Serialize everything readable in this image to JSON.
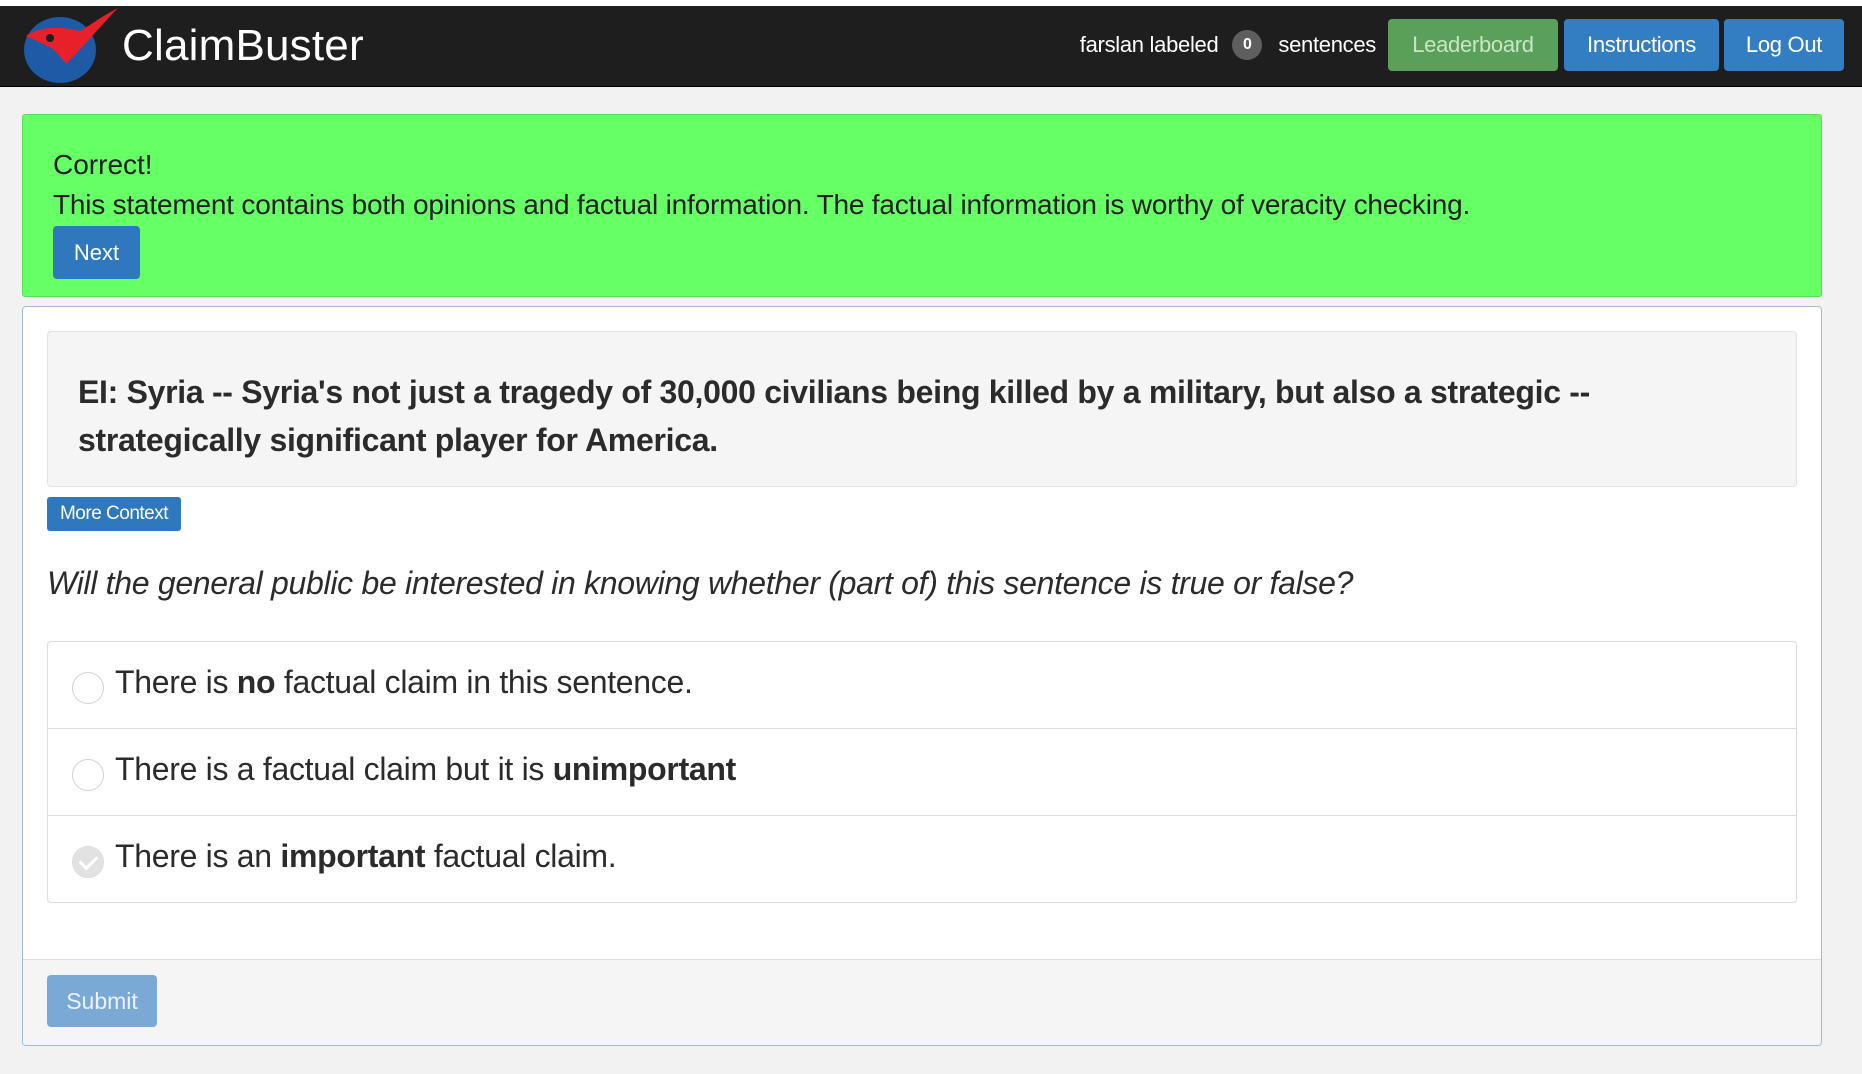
{
  "navbar": {
    "brand_name": "ClaimBuster",
    "username": "farslan",
    "labeled_text": "labeled",
    "count": "0",
    "sentences_text": "sentences",
    "leaderboard_label": "Leaderboard",
    "instructions_label": "Instructions",
    "logout_label": "Log Out",
    "brand_colors": {
      "red": "#e8202a",
      "blue": "#1f5aa6"
    }
  },
  "alert": {
    "title": "Correct!",
    "message": "This statement contains both opinions and factual information. The factual information is worthy of veracity checking.",
    "next_label": "Next",
    "color": "#66ff66"
  },
  "sentence": {
    "text": "EI: Syria -- Syria's not just a tragedy of 30,000 civilians being killed by a military, but also a strategic -- strategically significant player for America."
  },
  "more_context_label": "More Context",
  "question": "Will the general public be interested in knowing whether (part of) this sentence is true or false?",
  "options": [
    {
      "pre": "There is ",
      "bold": "no",
      "post": " factual claim in this sentence.",
      "checked": false
    },
    {
      "pre": "There is a factual claim but it is ",
      "bold": "unimportant",
      "post": "",
      "checked": false
    },
    {
      "pre": "There is an ",
      "bold": "important",
      "post": " factual claim.",
      "checked": true
    }
  ],
  "submit_label": "Submit"
}
